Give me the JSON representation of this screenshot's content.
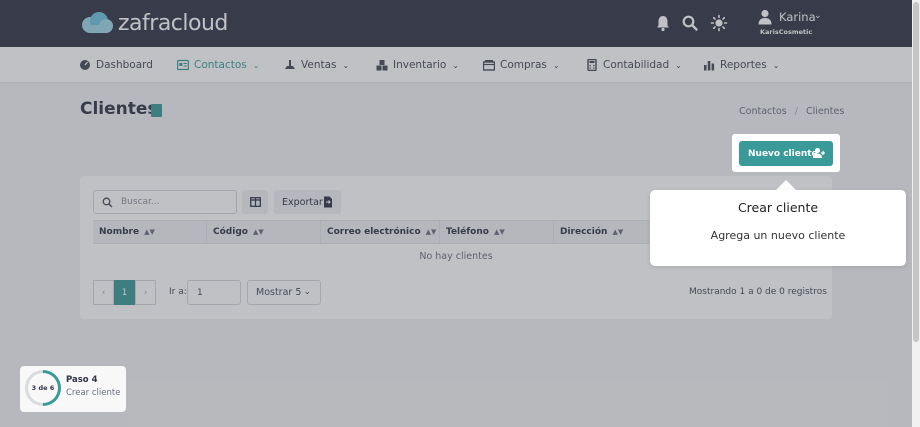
{
  "header": {
    "brand": "zafracloud",
    "user_name": "Karina",
    "company": "KarisCosmetic"
  },
  "nav": {
    "items": [
      {
        "label": "Dashboard",
        "icon": "dashboard-icon"
      },
      {
        "label": "Contactos",
        "icon": "contacts-icon"
      },
      {
        "label": "Ventas",
        "icon": "sales-icon"
      },
      {
        "label": "Inventario",
        "icon": "inventory-icon"
      },
      {
        "label": "Compras",
        "icon": "purchases-icon"
      },
      {
        "label": "Contabilidad",
        "icon": "accounting-icon"
      },
      {
        "label": "Reportes",
        "icon": "reports-icon"
      }
    ],
    "active": "Contactos"
  },
  "page": {
    "title": "Clientes",
    "breadcrumb": [
      "Contactos",
      "Clientes"
    ],
    "new_button": "Nuevo cliente"
  },
  "table": {
    "search_placeholder": "Buscar...",
    "export_label": "Exportar",
    "columns": [
      "Nombre",
      "Código",
      "Correo electrónico",
      "Teléfono",
      "Dirección"
    ],
    "empty_text": "No hay clientes",
    "current_page": "1",
    "goto_label": "Ir a:",
    "goto_value": "1",
    "page_size_label": "Mostrar 5",
    "records_text": "Mostrando 1 a 0 de 0 registros"
  },
  "tour": {
    "title": "Crear cliente",
    "description": "Agrega un nuevo cliente",
    "progress_label": "3 de 6",
    "progress": 0.5,
    "step_title": "Paso 4",
    "step_desc": "Crear cliente"
  },
  "colors": {
    "header_bg": "#2f3447",
    "accent": "#3a9a9a"
  }
}
